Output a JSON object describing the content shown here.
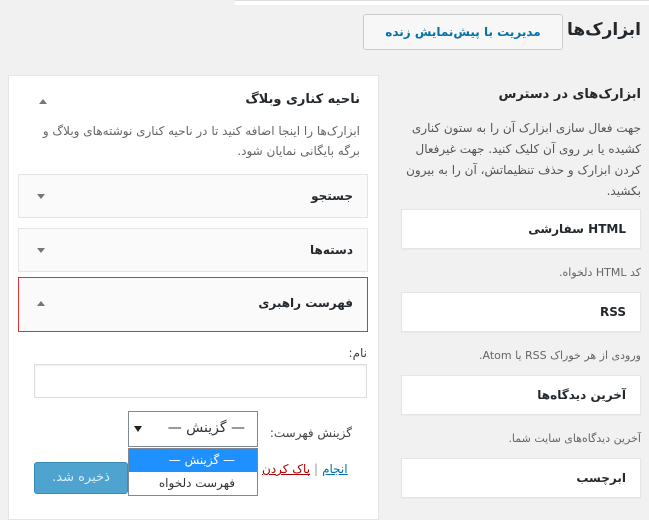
{
  "header": {
    "title": "ابزارک‌ها",
    "manage_label": "مدیریت با پیش‌نمایش زنده"
  },
  "available": {
    "title": "ابزارک‌های در دسترس",
    "description": "جهت فعال سازی ابزارک آن را به ستون کناری کشیده یا بر روی آن کلیک کنید. جهت غیرفعال کردن ابزارک و حذف تنظیماتش، آن را به بیرون بکشید.",
    "widgets": [
      {
        "title": "HTML سفارشی",
        "desc": "کد HTML دلخواه."
      },
      {
        "title": "RSS",
        "desc": "ورودی از هر خوراک RSS یا Atom."
      },
      {
        "title": "آخرین دیدگاه‌ها",
        "desc": "آخرین دیدگاه‌های سایت شما."
      },
      {
        "title": "ابرچسب",
        "desc": ""
      }
    ]
  },
  "sidebar": {
    "title": "ناحیه کناری وبلاگ",
    "description": "ابزارک‌ها را اینجا اضافه کنید تا در ناحیه کناری نوشته‌های وبلاگ و برگه بایگانی نمایان شود.",
    "widgets": [
      {
        "title": "جستجو"
      },
      {
        "title": "دسته‌ها"
      },
      {
        "title": "فهرست راهبری"
      }
    ],
    "form": {
      "name_label": "نام:",
      "name_value": "",
      "menu_label": "گزینش فهرست:",
      "menu_selected": "— گزینش —",
      "menu_options": [
        "— گزینش —",
        "فهرست دلخواه"
      ],
      "save_label": "ذخیره شد.",
      "delete_label": "پاک کردن",
      "separator": "|",
      "done_label": "انجام"
    }
  },
  "colors": {
    "accent": "#0073aa",
    "selected_option": "#1e90ff",
    "save_button": "#4fa3cf",
    "delete_link": "#a00000",
    "open_widget_border": "#dd3333"
  }
}
